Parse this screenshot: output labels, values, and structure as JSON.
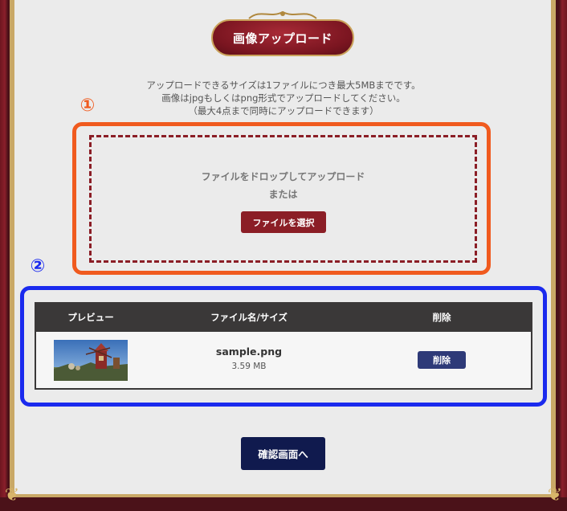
{
  "header": {
    "title": "画像アップロード"
  },
  "info": {
    "line1": "アップロードできるサイズは1ファイルにつき最大5MBまでです。",
    "line2": "画像はjpgもしくはpng形式でアップロードしてください。",
    "line3": "（最大4点まで同時にアップロードできます）"
  },
  "markers": {
    "one": "①",
    "two": "②"
  },
  "dropzone": {
    "line1": "ファイルをドロップしてアップロード",
    "line2": "または",
    "select_label": "ファイルを選択"
  },
  "table": {
    "headers": {
      "preview": "プレビュー",
      "name": "ファイル名/サイズ",
      "delete": "削除"
    },
    "rows": [
      {
        "name": "sample.png",
        "size": "3.59 MB",
        "delete_label": "削除"
      }
    ]
  },
  "footer": {
    "confirm_label": "確認画面へ"
  },
  "colors": {
    "accent_orange": "#f05a1e",
    "accent_blue": "#1a2aee",
    "brand_red": "#8b1e26",
    "navy": "#101a4e"
  }
}
